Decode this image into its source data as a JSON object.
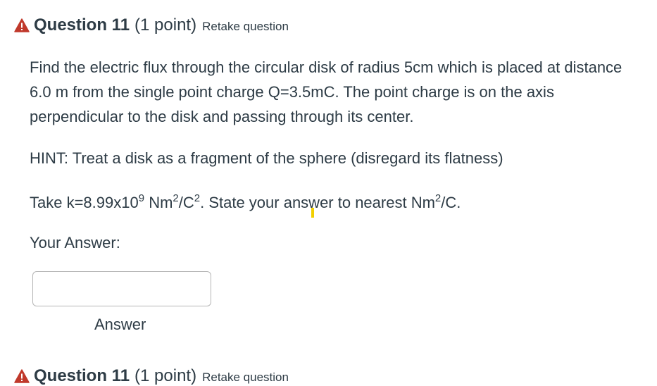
{
  "question": {
    "title": "Question 11",
    "points": "(1 point)",
    "retake_link": "Retake question",
    "paragraph_main": "Find the electric flux through the circular disk of radius 5cm which is placed at distance 6.0 m from the single point charge Q=3.5mC. The point charge is on the axis perpendicular to the disk and passing through its center.",
    "hint": "HINT: Treat a disk as a fragment of the sphere (disregard its flatness)",
    "take_k_prefix": "Take k=8.99x10",
    "take_k_exp": "9",
    "take_k_unit_a": " Nm",
    "take_k_unit_a_exp": "2",
    "take_k_unit_b": "/C",
    "take_k_unit_b_exp": "2",
    "take_k_mid": ". State your answer to nearest Nm",
    "take_k_end_exp": "2",
    "take_k_end": "/C.",
    "your_answer_label": "Your Answer:",
    "answer_value": "",
    "answer_caption": "Answer"
  },
  "next_question": {
    "title": "Question 11",
    "points": "(1 point)",
    "retake_link": "Retake question"
  },
  "colors": {
    "warning": "#c0392b",
    "text": "#2d3b45",
    "highlight": "#f2d000"
  },
  "icons": {
    "warning": "warning-triangle-icon"
  }
}
